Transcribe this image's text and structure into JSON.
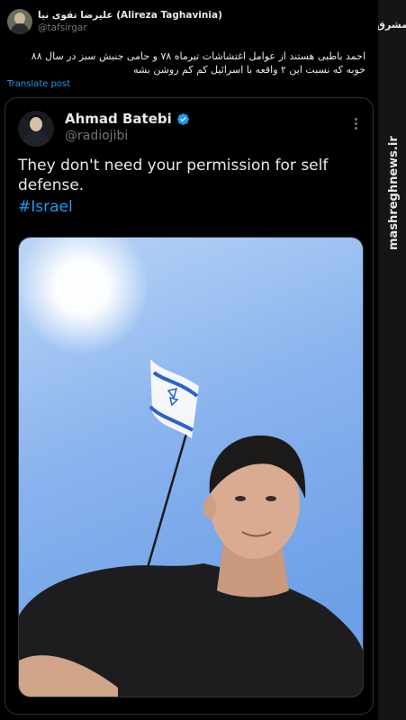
{
  "outer_tweet": {
    "name": "علیرضا تقوی نیا (Alireza Taghavinia)",
    "handle": "@tafsirgar",
    "text_line1": "احمد باطبی هستند از عوامل اغتشاشات تیرماه ۷۸ و حامی جنبش سبز در سال ۸۸",
    "text_line2": "خوبه که نسبت این ۲ واقعه با اسرائیل کم کم روشن بشه",
    "translate_label": "Translate post"
  },
  "quoted_tweet": {
    "name": "Ahmad Batebi",
    "handle": "@radiojibi",
    "text": "They don't need your permission for self defense.",
    "hashtag": "#Israel"
  },
  "watermark": {
    "logo_text": "مشرق",
    "site": "mashreghnews.ir"
  },
  "colors": {
    "accent": "#1d9bf0",
    "background": "#000000",
    "secondary_text": "#71767b"
  }
}
